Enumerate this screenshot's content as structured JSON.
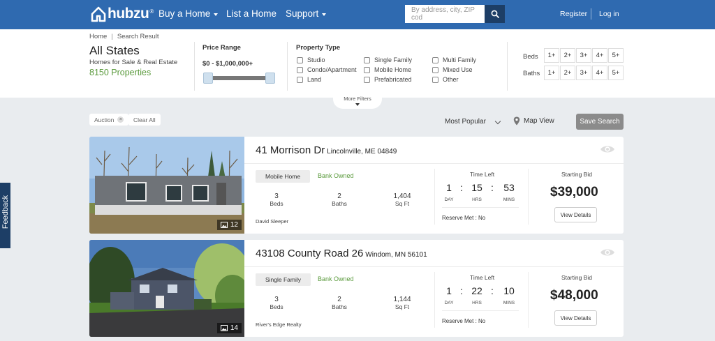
{
  "header": {
    "logo": "hubzu",
    "logo_reg": "®",
    "nav": [
      {
        "label": "Buy a Home",
        "has_dropdown": true
      },
      {
        "label": "List a Home",
        "has_dropdown": false
      },
      {
        "label": "Support",
        "has_dropdown": true
      }
    ],
    "search_placeholder": "By address, city, ZIP cod",
    "register": "Register",
    "login": "Log in",
    "color": "#2f6ab0"
  },
  "breadcrumb": {
    "home": "Home",
    "separator": "|",
    "current": "Search Result"
  },
  "heading": {
    "title": "All States",
    "subtitle": "Homes for Sale & Real Estate",
    "count": "8150 Properties"
  },
  "price_range": {
    "label": "Price Range",
    "value": "$0 - $1,000,000+"
  },
  "property_type": {
    "label": "Property Type",
    "options": [
      "Studio",
      "Condo/Apartment",
      "Land",
      "Single Family",
      "Mobile Home",
      "Prefabricated",
      "Multi Family",
      "Mixed Use",
      "Other"
    ]
  },
  "beds": {
    "label": "Beds",
    "options": [
      "1+",
      "2+",
      "3+",
      "4+",
      "5+"
    ]
  },
  "baths": {
    "label": "Baths",
    "options": [
      "1+",
      "2+",
      "3+",
      "4+",
      "5+"
    ]
  },
  "more_filters": "More Filters",
  "toolbar": {
    "chip_auction": "Auction",
    "chip_auction_x": "×",
    "clear_all": "Clear All",
    "sort": "Most Popular",
    "map_view": "Map View",
    "save_search": "Save Search"
  },
  "feedback": "Feedback",
  "listings": [
    {
      "address": "41 Morrison Dr",
      "city": "Lincolnville, ME 04849",
      "type": "Mobile Home",
      "status": "Bank Owned",
      "beds": "3",
      "beds_label": "Beds",
      "baths": "2",
      "baths_label": "Baths",
      "sqft": "1,404",
      "sqft_label": "Sq Ft",
      "agent": "David Sleeper",
      "photos": "12",
      "time_left_label": "Time Left",
      "days": "1",
      "hrs": "15",
      "mins": "53",
      "days_label": "DAY",
      "hrs_label": "HRS",
      "mins_label": "MINS",
      "reserve": "Reserve Met : No",
      "bid_label": "Starting Bid",
      "bid": "$39,000",
      "details": "View Details"
    },
    {
      "address": "43108 County Road 26",
      "city": "Windom, MN 56101",
      "type": "Single Family",
      "status": "Bank Owned",
      "beds": "3",
      "beds_label": "Beds",
      "baths": "2",
      "baths_label": "Baths",
      "sqft": "1,144",
      "sqft_label": "Sq Ft",
      "agent": "River's Edge Realty",
      "photos": "14",
      "time_left_label": "Time Left",
      "days": "1",
      "hrs": "22",
      "mins": "10",
      "days_label": "DAY",
      "hrs_label": "HRS",
      "mins_label": "MINS",
      "reserve": "Reserve Met : No",
      "bid_label": "Starting Bid",
      "bid": "$48,000",
      "details": "View Details"
    }
  ]
}
